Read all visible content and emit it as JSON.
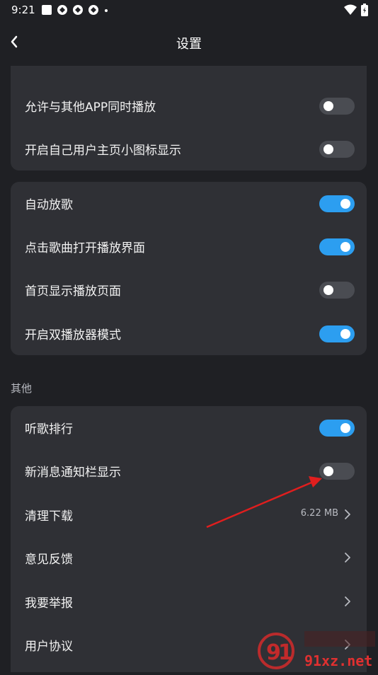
{
  "status": {
    "time": "9:21"
  },
  "nav": {
    "title": "设置"
  },
  "card1": {
    "items": [
      {
        "label": "允许与其他APP同时播放",
        "on": false
      },
      {
        "label": "开启自己用户主页小图标显示",
        "on": false
      }
    ]
  },
  "card2": {
    "items": [
      {
        "label": "自动放歌",
        "on": true
      },
      {
        "label": "点击歌曲打开播放界面",
        "on": true
      },
      {
        "label": "首页显示播放页面",
        "on": false
      },
      {
        "label": "开启双播放器模式",
        "on": true
      }
    ]
  },
  "section_other": {
    "title": "其他"
  },
  "card3": {
    "items": [
      {
        "label": "听歌排行",
        "on": true
      },
      {
        "label": "新消息通知栏显示",
        "on": false
      },
      {
        "label": "清理下载",
        "value": "6.22 MB"
      },
      {
        "label": "意见反馈"
      },
      {
        "label": "我要举报"
      },
      {
        "label": "用户协议"
      }
    ]
  },
  "colors": {
    "toggle_on": "#2c9ef0",
    "toggle_off": "#4a4c52",
    "card_bg": "#2f3035",
    "page_bg": "#1f2024",
    "annotation_arrow": "#e01e1e"
  },
  "watermark": {
    "text": "91xz.net"
  }
}
